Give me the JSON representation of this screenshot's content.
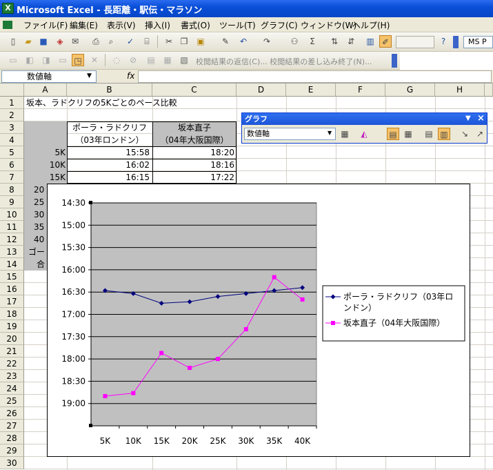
{
  "window": {
    "title": "Microsoft Excel - 長距離・駅伝・マラソン",
    "app_icon": "X"
  },
  "menu": [
    "ファイル(F)",
    "編集(E)",
    "表示(V)",
    "挿入(I)",
    "書式(O)",
    "ツール(T)",
    "グラフ(C)",
    "ウィンドウ(W)",
    "ヘルプ(H)"
  ],
  "toolbar": {
    "font_name": "MS P",
    "review_text": "校閲結果の返信(C)... 校閲結果の差し込み終了(N)..."
  },
  "formula_bar": {
    "name_box": "数値軸",
    "fx": "fx"
  },
  "columns": [
    "A",
    "B",
    "C",
    "D",
    "E",
    "F",
    "G",
    "H"
  ],
  "rows": [
    "1",
    "2",
    "3",
    "4",
    "5",
    "6",
    "7",
    "8",
    "9",
    "10",
    "11",
    "12",
    "13",
    "14",
    "15",
    "16",
    "17",
    "18",
    "19",
    "20",
    "21",
    "22",
    "23",
    "24",
    "25",
    "26",
    "27",
    "28",
    "29",
    "30"
  ],
  "sheet": {
    "a1": "坂本、ラドクリフの5Kごとのペース比較",
    "b3": "ポーラ・ラドクリフ",
    "b4": "（03年ロンドン）",
    "c3": "坂本直子",
    "c4": "（04年大阪国際）",
    "a5": "5K",
    "a6": "10K",
    "a7": "15K",
    "a8": "20",
    "a9": "25",
    "a10": "30",
    "a11": "35",
    "a12": "40",
    "a13": "ゴー",
    "a14": "合",
    "b5": "15:58",
    "b6": "16:02",
    "b7": "16:15",
    "c5": "18:20",
    "c6": "18:16",
    "c7": "17:22"
  },
  "chart_toolbar": {
    "title": "グラフ",
    "selected": "数値軸",
    "close": "×",
    "menu_arrow": "▼"
  },
  "chart_data": {
    "type": "line",
    "categories": [
      "5K",
      "10K",
      "15K",
      "20K",
      "25K",
      "30K",
      "35K",
      "40K"
    ],
    "y_axis": {
      "reversed": true,
      "min_sec": 840,
      "max_sec": 1140,
      "step_sec": 30,
      "tick_labels": [
        "14:30",
        "15:00",
        "15:30",
        "16:00",
        "16:30",
        "17:00",
        "17:30",
        "18:00",
        "18:30",
        "19:00"
      ]
    },
    "series": [
      {
        "name": "ポーラ・ラドクリフ（03年ロンドン）",
        "color": "#000080",
        "marker": "diamond",
        "values_sec": [
          958,
          962,
          975,
          973,
          966,
          962,
          958,
          954
        ]
      },
      {
        "name": "坂本直子（04年大阪国際）",
        "color": "#ff00ff",
        "marker": "square",
        "values_sec": [
          1100,
          1096,
          1042,
          1062,
          1050,
          1010,
          940,
          970
        ]
      }
    ],
    "legend": "right",
    "gridlines": true,
    "plot_bg": "#c0c0c0"
  }
}
